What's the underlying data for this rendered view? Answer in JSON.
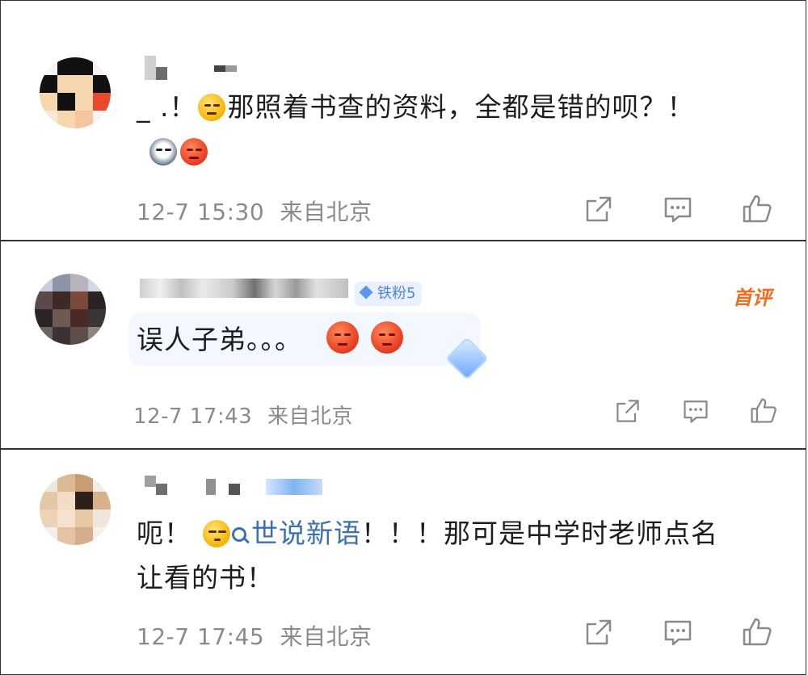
{
  "comments": [
    {
      "text_before_emoji": "_ .！",
      "text_after_emoji": "那照着书查的资料，全都是错的呗？！",
      "emojis": [
        "thinking-emoji",
        "husky-emoji",
        "angry-emoji"
      ],
      "time": "12-7 15:30",
      "location": "来自北京"
    },
    {
      "badge": "铁粉5",
      "first_comment_tag": "首评",
      "text": "误人子弟。。。",
      "emojis": [
        "angry-emoji",
        "angry-emoji"
      ],
      "time": "12-7 17:43",
      "location": "来自北京"
    },
    {
      "text_prefix": "呃！",
      "topic": "世说新语",
      "text_suffix": "！！！那可是中学时老师点名让看的书！",
      "emojis": [
        "smirk-emoji",
        "search-icon"
      ],
      "time": "12-7 17:45",
      "location": "来自北京"
    }
  ],
  "colors": {
    "meta_gray": "#8a8a8a",
    "topic_blue": "#3b6fb6",
    "first_comment_orange": "#ef6b1e",
    "badge_blue": "#4b86e6"
  }
}
